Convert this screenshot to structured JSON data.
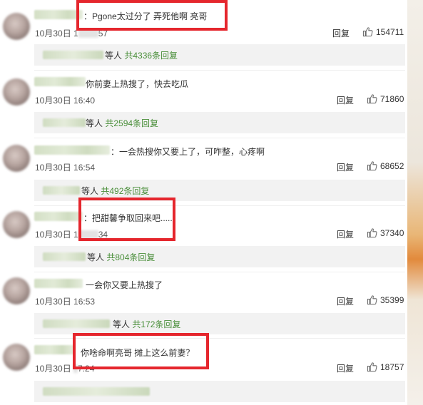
{
  "comments": [
    {
      "text": "：Pgone太过分了 弄死他啊 亮哥",
      "date": "10月30日",
      "time_prefix": "1",
      "time_suffix": "57",
      "reply_label": "回复",
      "likes": "154711",
      "others_label": "等人",
      "reply_count": "共4336条回复"
    },
    {
      "text": "你前妻上热搜了，快去吃瓜",
      "date": "10月30日",
      "time": "16:40",
      "reply_label": "回复",
      "likes": "71860",
      "others_label": "等人",
      "reply_count": "共2594条回复"
    },
    {
      "text": "：一会热搜你又要上了，可咋整，心疼啊",
      "date": "10月30日",
      "time": "16:54",
      "reply_label": "回复",
      "likes": "68652",
      "others_label": "等人",
      "reply_count": "共492条回复"
    },
    {
      "text": "：把甜馨争取回来吧......",
      "date": "10月30日",
      "time_prefix": "1",
      "time_suffix": "34",
      "reply_label": "回复",
      "likes": "37340",
      "others_label": "等人",
      "reply_count": "共804条回复"
    },
    {
      "text": "一会你又要上热搜了",
      "date": "10月30日",
      "time": "16:53",
      "reply_label": "回复",
      "likes": "35399",
      "others_label": "等人",
      "reply_count": "共172条回复"
    },
    {
      "text": "你啥命啊亮哥 摊上这么前妻？",
      "date": "10月30日",
      "time_prefix": "",
      "time_suffix": "7:24",
      "reply_label": "回复",
      "likes": "18757"
    }
  ],
  "colors": {
    "highlight": "#e5262d",
    "reply_link": "#4a8f3a",
    "reply_bg": "#f2f2f2"
  },
  "icons": {
    "like": "thumbs-up-icon"
  }
}
